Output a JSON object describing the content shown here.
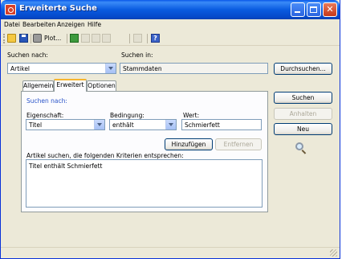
{
  "window": {
    "title": "Erweiterte Suche",
    "icon": "app-search-icon",
    "controls": [
      "minimize-icon",
      "maximize-icon",
      "close-icon"
    ]
  },
  "menu": {
    "items": [
      {
        "label": "Datei"
      },
      {
        "label": "Bearbeiten"
      },
      {
        "label": "Anzeigen"
      },
      {
        "label": "Hilfe"
      }
    ]
  },
  "toolbar": {
    "plot_label": "Plot...",
    "help_glyph": "?",
    "icons": [
      "open-folder-icon",
      "save-icon",
      "plot-icon",
      "excel-icon",
      "cut-icon",
      "copy-icon",
      "paste-icon",
      "print-icon",
      "help-icon"
    ]
  },
  "search": {
    "search_for_label": "Suchen nach:",
    "search_for_value": "Artikel",
    "search_in_label": "Suchen in:",
    "search_in_value": "Stammdaten",
    "browse_button": "Durchsuchen..."
  },
  "tabs": [
    {
      "label": "Allgemein",
      "active": false
    },
    {
      "label": "Erweitert",
      "active": true
    },
    {
      "label": "Optionen",
      "active": false
    }
  ],
  "advanced": {
    "section_title": "Suchen nach:",
    "property_label": "Eigenschaft:",
    "property_value": "Titel",
    "condition_label": "Bedingung:",
    "condition_value": "enthält",
    "value_label": "Wert:",
    "value_value": "Schmierfett",
    "add_button": "Hinzufügen",
    "remove_button": "Entfernen",
    "criteria_label": "Artikel suchen, die folgenden Kriterien entsprechen:",
    "criteria": [
      "Titel enthält Schmierfett"
    ]
  },
  "actions": {
    "search_button": "Suchen",
    "stop_button": "Anhalten",
    "new_button": "Neu"
  },
  "colors": {
    "titlebar": "#0a58e8",
    "dialog_bg": "#ece9d8",
    "tab_accent": "#f7b630",
    "link_blue": "#2a54c9",
    "close_red": "#c4381a"
  }
}
